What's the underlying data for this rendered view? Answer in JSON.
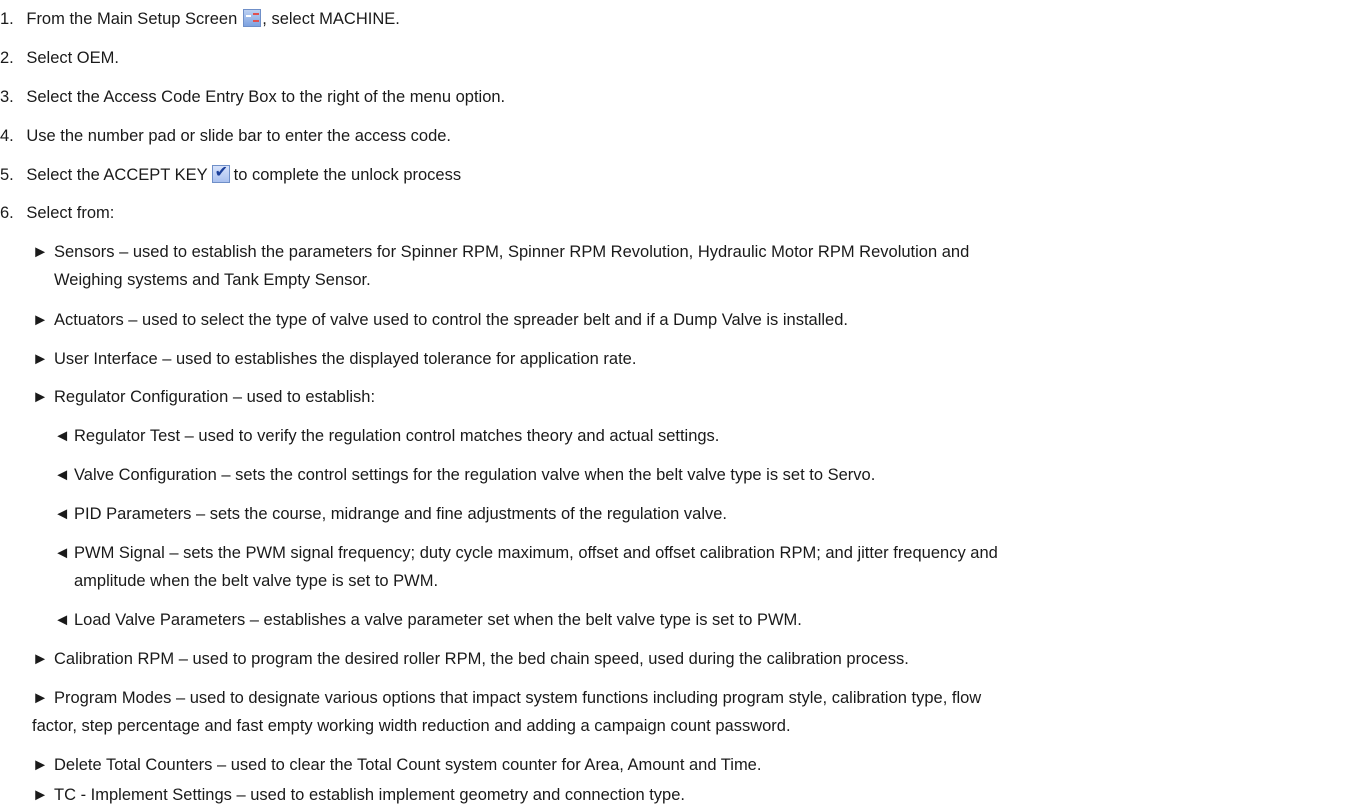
{
  "steps": [
    {
      "num": "1.",
      "text_before": "From the Main Setup Screen",
      "icon": "main-setup-icon",
      "text_after": ", select MACHINE."
    },
    {
      "num": "2.",
      "text": "Select OEM."
    },
    {
      "num": "3.",
      "text": "Select the Access Code Entry Box to the right of the menu option."
    },
    {
      "num": "4.",
      "text": "Use the number pad or slide bar to enter the access code."
    },
    {
      "num": "5.",
      "text_before": "Select the ACCEPT KEY",
      "icon": "accept-key-icon",
      "text_after": "to complete the unlock process"
    },
    {
      "num": "6.",
      "text": "Select from:"
    }
  ],
  "bullet_glyph": "►",
  "sub_glyph": "◄",
  "bullets": {
    "sensors_1": "Sensors – used to establish the parameters for Spinner RPM, Spinner RPM Revolution, Hydraulic Motor RPM Revolution and",
    "sensors_2": "Weighing systems and Tank Empty Sensor.",
    "actuators": "Actuators – used to select the type of valve used to control the spreader belt and if a Dump Valve is installed.",
    "user_interface": "User Interface – used to establishes the displayed tolerance for application rate.",
    "regulator": "Regulator Configuration – used to establish:",
    "calibration": "Calibration RPM – used to program the desired roller RPM, the bed chain speed, used during the calibration process.",
    "program_1": "Program Modes – used to designate various options that impact system functions including program style, calibration type, flow",
    "program_2": "factor, step percentage and fast empty working width reduction and adding a campaign count password.",
    "delete": "Delete Total Counters – used to clear the Total Count system counter for Area, Amount and Time.",
    "tc": "TC - Implement Settings – used to establish implement geometry and connection type."
  },
  "sub_items": {
    "regulator_test": "Regulator Test – used to verify the regulation control matches theory and actual settings.",
    "valve_config": "Valve Configuration – sets the control settings for the regulation valve when the belt valve type is set to Servo.",
    "pid": "PID Parameters – sets the course, midrange and fine adjustments of the regulation valve.",
    "pwm_1": "PWM Signal – sets the PWM signal frequency; duty cycle maximum, offset and offset calibration RPM; and jitter frequency and",
    "pwm_2": "amplitude when the belt valve type is set to PWM.",
    "load_valve": "Load Valve Parameters – establishes a valve parameter set when the belt valve type is set to PWM."
  },
  "colors": {
    "text": "#1a1a1a",
    "icon_border": "#6f8fc8",
    "icon_fill": "#a9c0ef"
  }
}
